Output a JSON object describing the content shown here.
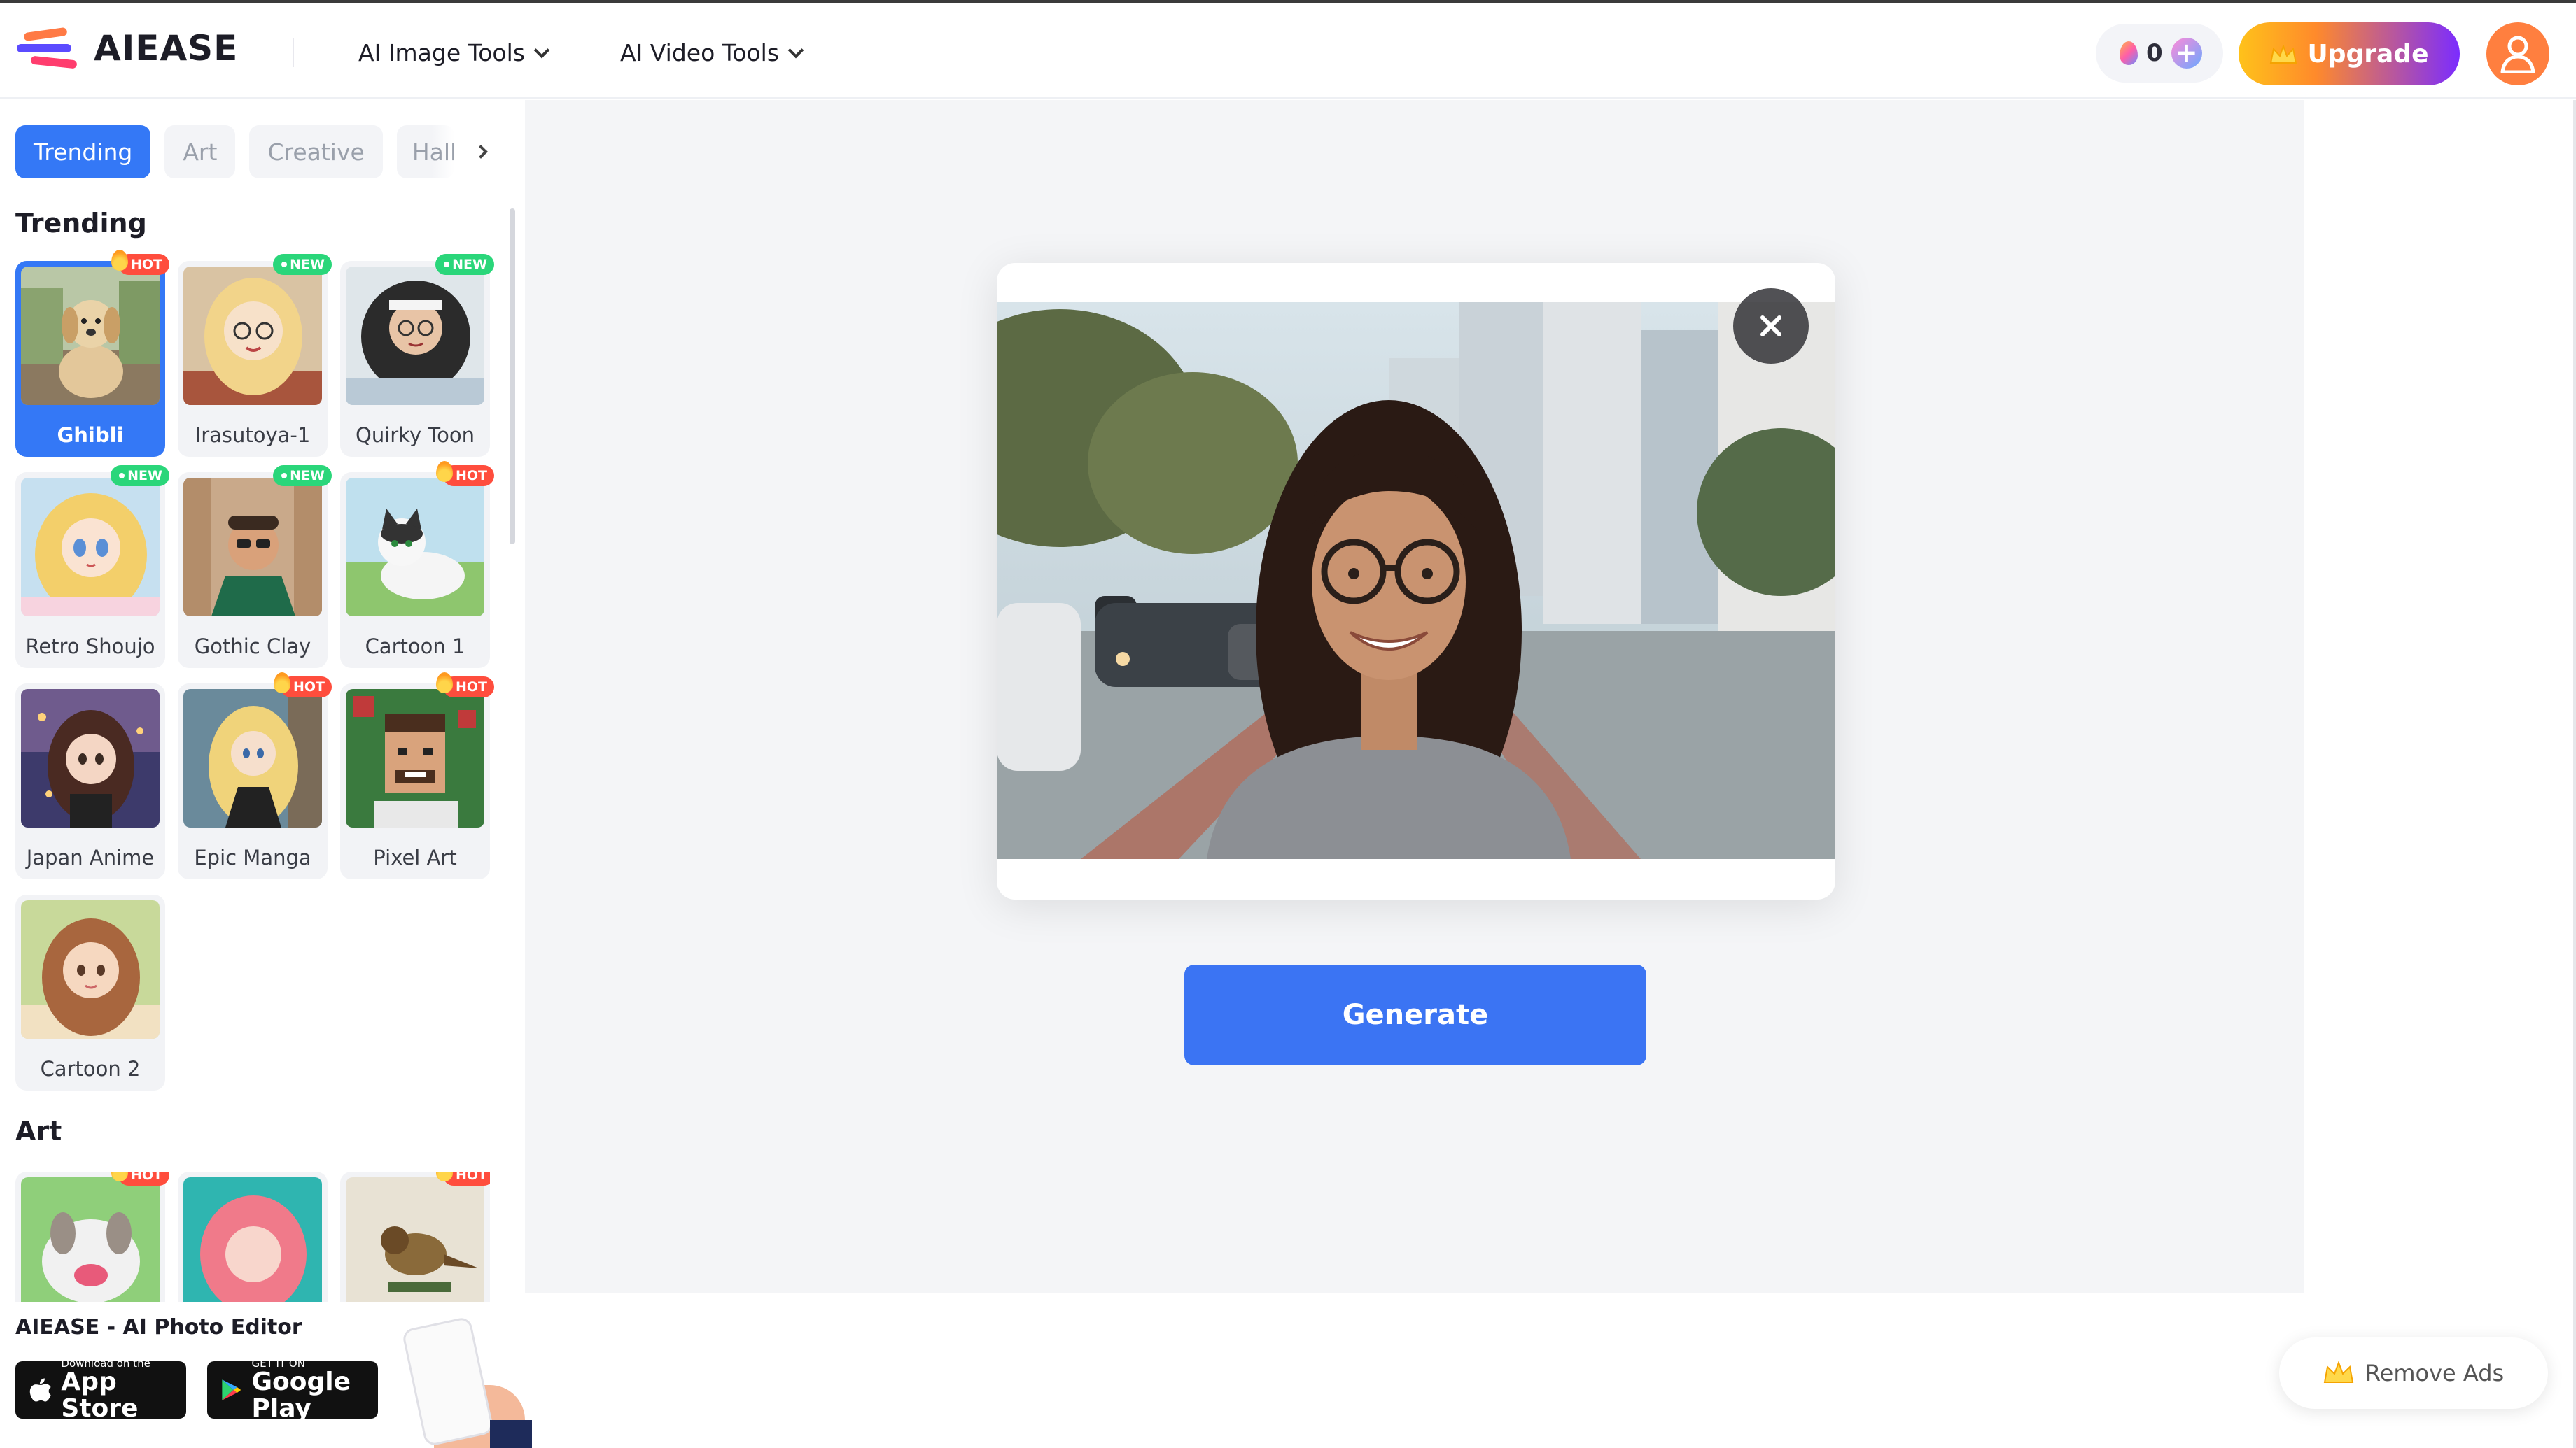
{
  "brand": {
    "name": "AIEASE"
  },
  "nav": {
    "image_tools": "AI Image Tools",
    "video_tools": "AI Video Tools"
  },
  "account": {
    "credits": "0",
    "upgrade_label": "Upgrade"
  },
  "sidebar": {
    "tabs": [
      {
        "label": "Trending",
        "active": true
      },
      {
        "label": "Art",
        "active": false
      },
      {
        "label": "Creative",
        "active": false
      },
      {
        "label": "Hallo",
        "active": false
      }
    ],
    "trending_title": "Trending",
    "trending_styles": [
      {
        "label": "Ghibli",
        "badge": "HOT",
        "selected": true
      },
      {
        "label": "Irasutoya-1",
        "badge": "NEW"
      },
      {
        "label": "Quirky Toon",
        "badge": "NEW"
      },
      {
        "label": "Retro Shoujo",
        "badge": "NEW"
      },
      {
        "label": "Gothic Clay",
        "badge": "NEW"
      },
      {
        "label": "Cartoon 1",
        "badge": "HOT"
      },
      {
        "label": "Japan Anime",
        "badge": ""
      },
      {
        "label": "Epic Manga",
        "badge": "HOT"
      },
      {
        "label": "Pixel Art",
        "badge": "HOT"
      },
      {
        "label": "Cartoon 2",
        "badge": ""
      }
    ],
    "art_title": "Art",
    "art_styles": [
      {
        "badge": "HOT"
      },
      {
        "badge": ""
      },
      {
        "badge": "HOT"
      }
    ]
  },
  "promo": {
    "title": "AIEASE - AI Photo Editor",
    "app_store_small": "Download on the",
    "app_store_big": "App Store",
    "google_play_small": "GET IT ON",
    "google_play_big": "Google Play"
  },
  "editor": {
    "generate_label": "Generate"
  },
  "ads": {
    "remove_label": "Remove Ads"
  },
  "colors": {
    "accent": "#3478f6",
    "hot": "#ff4d3d",
    "new": "#2ad67a"
  }
}
